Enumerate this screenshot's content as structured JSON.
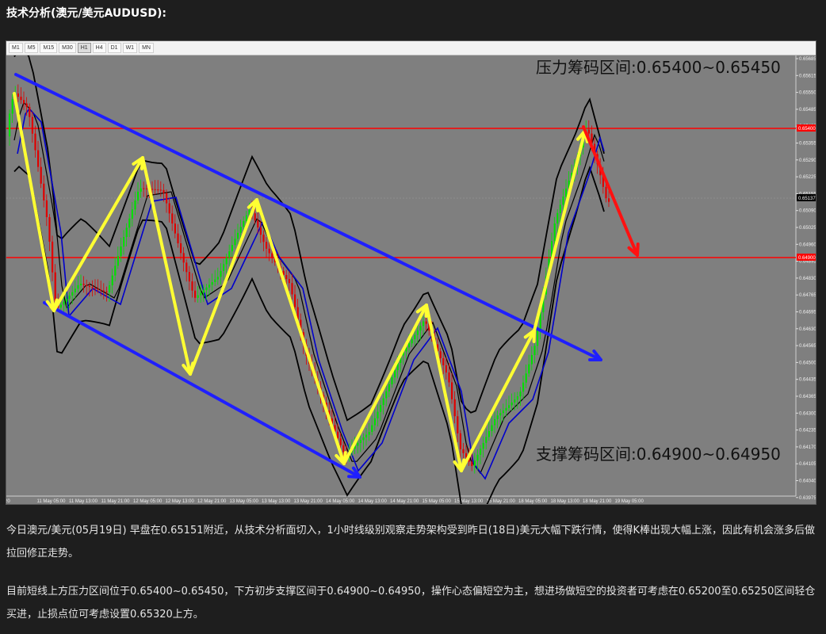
{
  "title": "技术分析(澳元/美元AUDUSD):",
  "timeframes": [
    "M1",
    "M5",
    "M15",
    "M30",
    "H1",
    "H4",
    "D1",
    "W1",
    "MN"
  ],
  "active_timeframe": "H1",
  "annotations": {
    "resistance": "压力筹码区间:0.65400~0.65450",
    "support": "支撑筹码区间:0.64900~0.64950"
  },
  "price_axis": [
    "0.65685",
    "0.65615",
    "0.65550",
    "0.65485",
    "0.65420",
    "0.65355",
    "0.65290",
    "0.65225",
    "0.65155",
    "0.65090",
    "0.65025",
    "0.64960",
    "0.64895",
    "0.64830",
    "0.64765",
    "0.64695",
    "0.64630",
    "0.64565",
    "0.64500",
    "0.64435",
    "0.64365",
    "0.64300",
    "0.64235",
    "0.64170",
    "0.64105",
    "0.64040",
    "0.63975"
  ],
  "price_tags": {
    "upper": "0.65400",
    "current": "0.65137",
    "lower": "0.64900"
  },
  "time_axis": [
    "20",
    "11 May 05:00",
    "11 May 13:00",
    "11 May 21:00",
    "12 May 05:00",
    "12 May 13:00",
    "12 May 21:00",
    "13 May 05:00",
    "13 May 13:00",
    "13 May 21:00",
    "14 May 05:00",
    "14 May 13:00",
    "14 May 21:00",
    "15 May 05:00",
    "15 May 13:00",
    "15 May 21:00",
    "18 May 05:00",
    "18 May 13:00",
    "18 May 21:00",
    "19 May 05:00"
  ],
  "colors": {
    "chart_bg": "#7f7f7f",
    "bull": "#00e000",
    "bear": "#e00000",
    "channel": "#1f1fff",
    "arrows": "#ffff33",
    "red_arrow": "#ff1111",
    "hline": "#ff0000",
    "ma": "#0000cc",
    "band": "#000000"
  },
  "paragraphs": [
    "今日澳元/美元(05月19日) 早盘在0.65151附近，从技术分析面切入，1小时线级别观察走势架构受到昨日(18日)美元大幅下跌行情，使得K棒出现大幅上涨，因此有机会涨多后做拉回修正走势。",
    "目前短线上方压力区间位于0.65400~0.65450，下方初步支撑区间于0.64900~0.64950，操作心态偏短空为主，想进场做短空的投资者可考虑在0.65200至0.65250区间轻仓买进，止损点位可考虑设置0.65320上方。"
  ]
}
